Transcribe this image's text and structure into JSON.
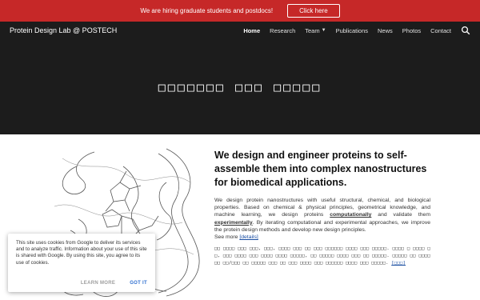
{
  "banner": {
    "text": "We are hiring graduate students and postdocs!",
    "button_label": "Click here"
  },
  "header": {
    "site_title": "Protein Design Lab @ POSTECH",
    "nav": [
      "Home",
      "Research",
      "Team",
      "Publications",
      "News",
      "Photos",
      "Contact"
    ],
    "active_item": "Home"
  },
  "hero": {
    "title": "□□□□□□□ □□□ □□□□□"
  },
  "main": {
    "headline": "We design and engineer proteins to self-assemble them into complex nanostructures for biomedical applications.",
    "para_1": "We design protein nanostructures with useful structural, chemical, and biological properties. Based on chemical & physical principles, geometrical knowledge, and machine learning, we design proteins ",
    "para_link_1": "computationally",
    "para_2": " and validate them ",
    "para_link_2": "experimentally",
    "para_3": ". By iterating computational and experimental approaches, we improve the protein design methods and develop new design principles.",
    "see_more_prefix": "See more ",
    "see_more_link": "[details]",
    "korean_text": "□□ □□□□ □□□ □□□, □□□, □□□□ □□□ □□ □□□ □□□□□□ □□□□ □□□ □□□□□. □□□□ □ □□□□ □ □, □□□ □□□□ □□□ □□□□ □□□□ □□□□□, □□ □□□□□ □□□□ □□□ □□ □□□□□. □□□□□ □□ □□□□ □□ □□/□□□ □□ □□□□□ □□□ □□ □□□ □□□□ □□□ □□□□□□ □□□□ □□□ □□□□□.",
    "korean_link": "[□□□]"
  },
  "cookie": {
    "text": "This site uses cookies from Google to deliver its services and to analyze traffic. Information about your use of this site is shared with Google. By using this site, you agree to its use of cookies.",
    "learn_more": "LEARN MORE",
    "got_it": "GOT IT"
  },
  "colors": {
    "banner": "#c62828",
    "header_bg": "#1c1c1c",
    "link": "#1a4ea2",
    "cookie_accent": "#2f6fd0"
  },
  "icons": [
    "search-icon",
    "chevron-down-icon"
  ]
}
